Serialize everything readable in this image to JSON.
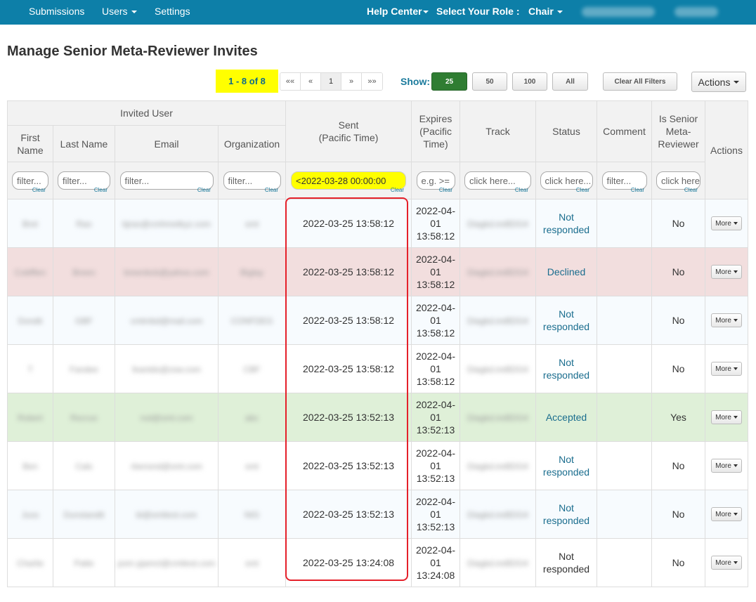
{
  "nav": {
    "submissions": "Submissions",
    "users": "Users",
    "settings": "Settings",
    "help_center": "Help Center",
    "select_role_label": "Select Your Role :",
    "role": "Chair"
  },
  "page": {
    "title": "Manage Senior Meta-Reviewer Invites"
  },
  "pager": {
    "count": "1 - 8 of 8",
    "first": "««",
    "prev": "«",
    "page": "1",
    "next": "»",
    "last": "»»",
    "show_label": "Show:",
    "sizes": [
      "25",
      "50",
      "100",
      "All"
    ],
    "active_size": "25",
    "clear_filters": "Clear All Filters",
    "actions": "Actions"
  },
  "table": {
    "group_header": "Invited User",
    "headers": {
      "first_name": "First Name",
      "last_name": "Last Name",
      "email": "Email",
      "organization": "Organization",
      "sent": "Sent",
      "sent_sub": "(Pacific Time)",
      "expires": "Expires (Pacific Time)",
      "track": "Track",
      "status": "Status",
      "comment": "Comment",
      "is_senior": "Is Senior Meta-Reviewer",
      "actions": "Actions"
    },
    "filters": {
      "first_name": "filter...",
      "last_name": "filter...",
      "email": "filter...",
      "organization": "filter...",
      "sent": "<2022-03-28 00:00:00",
      "expires": "e.g. >=",
      "track": "click here...",
      "status": "click here...",
      "comment": "filter...",
      "is_senior": "click here...",
      "clear": "Clear"
    },
    "more_label": "More",
    "rows": [
      {
        "first": "Bret",
        "last": "Rao",
        "email": "bjrao@cmhmetkyz.com",
        "org": "smt",
        "sent": "2022-03-25 13:58:12",
        "expires": [
          "2022-04-",
          "01",
          "13:58:12"
        ],
        "track": "Diagkd.ireBDG4",
        "status": [
          "Not",
          "responded"
        ],
        "senior": "No"
      },
      {
        "first": "Cobfflen",
        "last": "Breen",
        "email": "breenbcb@yahoo.com",
        "org": "Biglay",
        "sent": "2022-03-25 13:58:12",
        "expires": [
          "2022-04-",
          "01",
          "13:58:12"
        ],
        "track": "Diagkd.ireBDG4",
        "status": [
          "Declined"
        ],
        "senior": "No"
      },
      {
        "first": "Dondti",
        "last": "GBF",
        "email": "cmtmbd@mail.com",
        "org": "CONFDEG",
        "sent": "2022-03-25 13:58:12",
        "expires": [
          "2022-04-",
          "01",
          "13:58:12"
        ],
        "track": "Diagkd.ireBDG4",
        "status": [
          "Not",
          "responded"
        ],
        "senior": "No"
      },
      {
        "first": "T",
        "last": "Fandee",
        "email": "feantds@zsw.com",
        "org": "CBF",
        "sent": "2022-03-25 13:58:12",
        "expires": [
          "2022-04-",
          "01",
          "13:58:12"
        ],
        "track": "Diagkd.ireBDG4",
        "status": [
          "Not",
          "responded"
        ],
        "senior": "No"
      },
      {
        "first": "Robert",
        "last": "Recruo",
        "email": "rod@smt.com",
        "org": "abc",
        "sent": "2022-03-25 13:52:13",
        "expires": [
          "2022-04-",
          "01",
          "13:52:13"
        ],
        "track": "Diagkd.ireBDG4",
        "status": [
          "Accepted"
        ],
        "senior": "Yes"
      },
      {
        "first": "Ben",
        "last": "Cals",
        "email": "rbenond@smt.com",
        "org": "smt",
        "sent": "2022-03-25 13:52:13",
        "expires": [
          "2022-04-",
          "01",
          "13:52:13"
        ],
        "track": "Diagkd.ireBDG4",
        "status": [
          "Not",
          "responded"
        ],
        "senior": "No"
      },
      {
        "first": "Juss",
        "last": "Dunstandtt",
        "email": "bl@smttest.com",
        "org": "NIG",
        "sent": "2022-03-25 13:52:13",
        "expires": [
          "2022-04-",
          "01",
          "13:52:13"
        ],
        "track": "Diagkd.ireBDG4",
        "status": [
          "Not",
          "responded"
        ],
        "senior": "No"
      },
      {
        "first": "Charlie",
        "last": "Patte",
        "email": "pom pjamct@cmttest.com",
        "org": "smt",
        "sent": "2022-03-25 13:24:08",
        "expires": [
          "2022-04-",
          "01",
          "13:24:08"
        ],
        "track": "Diagkd.ireBDG4",
        "status": [
          "Not",
          "responded"
        ],
        "senior": "No"
      }
    ]
  }
}
